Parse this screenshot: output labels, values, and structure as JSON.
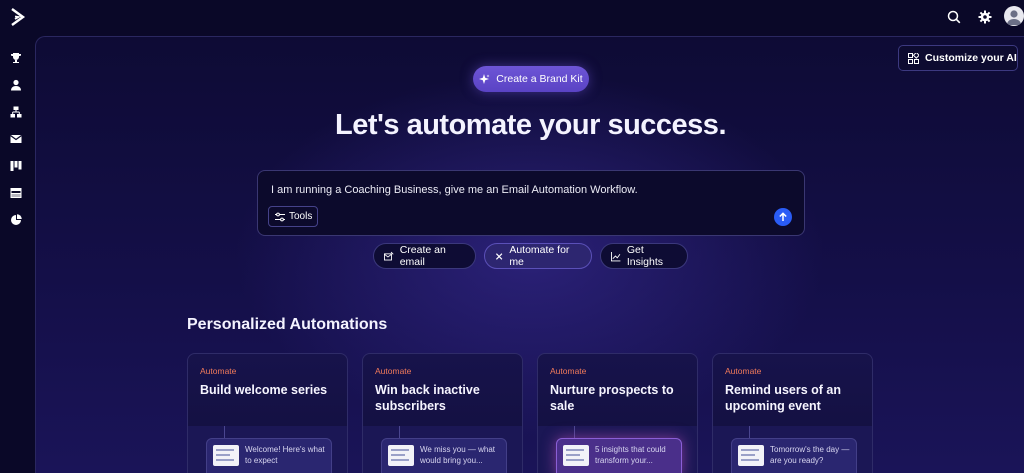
{
  "colors": {
    "background": "#0a0828",
    "accent_purple": "#6d55d6",
    "send_blue": "#2a5cf6",
    "tag_orange": "#f07a5a"
  },
  "rail": {
    "logo_icon": "activecampaign-chevron-logo",
    "items": [
      {
        "icon": "trophy-icon"
      },
      {
        "icon": "person-icon"
      },
      {
        "icon": "org-chart-icon"
      },
      {
        "icon": "envelope-icon"
      },
      {
        "icon": "kanban-icon"
      },
      {
        "icon": "browser-window-icon"
      },
      {
        "icon": "pie-chart-icon"
      }
    ]
  },
  "topbar": {
    "icons": [
      "search-icon",
      "gear-icon",
      "avatar"
    ]
  },
  "customize_button": {
    "label": "Customize your AI",
    "icon": "widgets-icon"
  },
  "brand_kit_button": {
    "label": "Create a Brand Kit",
    "icon": "sparkle-icon"
  },
  "headline": "Let's automate your success.",
  "prompt": {
    "value": "I am running a Coaching Business, give me an Email Automation Workflow.",
    "tools_label": "Tools",
    "send_icon": "arrow-up-icon"
  },
  "chips": [
    {
      "label": "Create an email",
      "icon": "email-edit-icon",
      "active": false
    },
    {
      "label": "Automate for me",
      "icon": "close-icon",
      "active": true
    },
    {
      "label": "Get Insights",
      "icon": "trend-chart-icon",
      "active": false
    }
  ],
  "section_title": "Personalized Automations",
  "cards": [
    {
      "tag": "Automate",
      "title": "Build welcome series",
      "preview": "Welcome! Here's what to expect"
    },
    {
      "tag": "Automate",
      "title": "Win back inactive subscribers",
      "preview": "We miss you — what would bring you..."
    },
    {
      "tag": "Automate",
      "title": "Nurture prospects to sale",
      "preview": "5 insights that could transform your..."
    },
    {
      "tag": "Automate",
      "title": "Remind users of an upcoming event",
      "preview": "Tomorrow's the day — are you ready?"
    }
  ]
}
